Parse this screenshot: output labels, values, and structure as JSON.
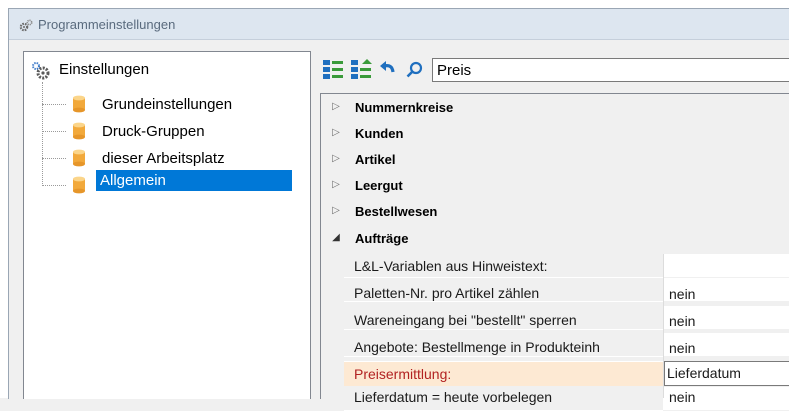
{
  "window": {
    "title": "Programmeinstellungen"
  },
  "tree": {
    "root": {
      "label": "Einstellungen",
      "icon": "gears-icon"
    },
    "items": [
      {
        "label": "Grundeinstellungen",
        "icon": "database-icon"
      },
      {
        "label": "Druck-Gruppen",
        "icon": "database-icon"
      },
      {
        "label": "dieser Arbeitsplatz",
        "icon": "database-icon"
      },
      {
        "label": "Allgemein",
        "icon": "database-icon",
        "selected": true
      }
    ]
  },
  "toolbar": {
    "icons": [
      "categorized-view-icon",
      "alphabetical-view-icon",
      "undo-icon",
      "search-icon"
    ],
    "search_value": "Preis"
  },
  "grid": {
    "categories": [
      {
        "label": "Nummernkreise",
        "expanded": false
      },
      {
        "label": "Kunden",
        "expanded": false
      },
      {
        "label": "Artikel",
        "expanded": false
      },
      {
        "label": "Leergut",
        "expanded": false
      },
      {
        "label": "Bestellwesen",
        "expanded": false
      },
      {
        "label": "Aufträge",
        "expanded": true
      }
    ],
    "properties": [
      {
        "name": "L&L-Variablen aus Hinweistext:",
        "value": ""
      },
      {
        "name": "Paletten-Nr. pro Artikel zählen",
        "value": "nein"
      },
      {
        "name": "Wareneingang bei \"bestellt\" sperren",
        "value": "nein"
      },
      {
        "name": "Angebote: Bestellmenge in Produkteinh",
        "value": "nein"
      },
      {
        "name": "Preisermittlung:",
        "value": "Lieferdatum",
        "selected": true
      },
      {
        "name": "Lieferdatum = heute vorbelegen",
        "value": "nein"
      }
    ]
  },
  "colors": {
    "selection": "#0078d7",
    "selected_property_name": "#b22222",
    "selected_row_background": "#fde9d3"
  }
}
